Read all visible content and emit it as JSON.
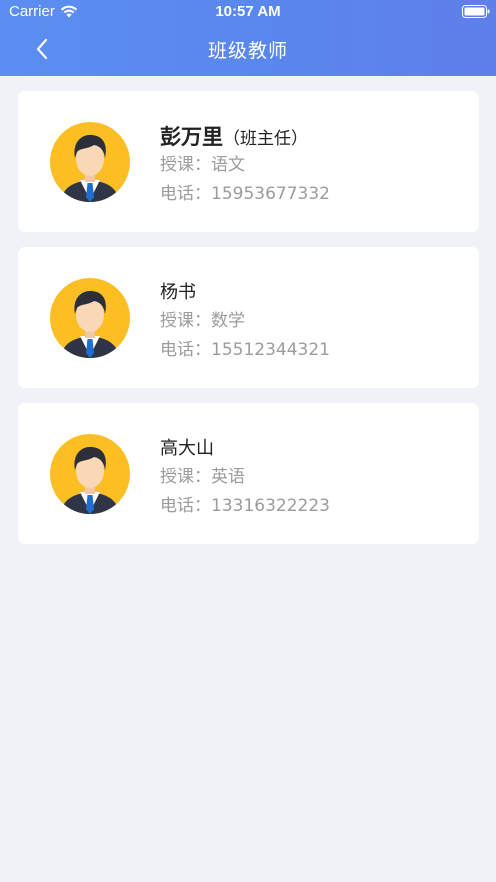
{
  "status_bar": {
    "carrier": "Carrier",
    "time": "10:57 AM"
  },
  "nav": {
    "title": "班级教师",
    "back_icon": "chevron-left-icon"
  },
  "colors": {
    "header": "#5b8ef0",
    "background": "#f1f2f7",
    "avatar_bg": "#fbbf24"
  },
  "teachers": [
    {
      "name": "彭万里",
      "role": "（班主任）",
      "subject_label": "授课：",
      "subject": "语文",
      "phone_label": "电话：",
      "phone": "15953677332"
    },
    {
      "name": "杨书",
      "subject_label": "授课：",
      "subject": "数学",
      "phone_label": "电话：",
      "phone": "15512344321"
    },
    {
      "name": "高大山",
      "subject_label": "授课：",
      "subject": "英语",
      "phone_label": "电话：",
      "phone": "13316322223"
    }
  ]
}
